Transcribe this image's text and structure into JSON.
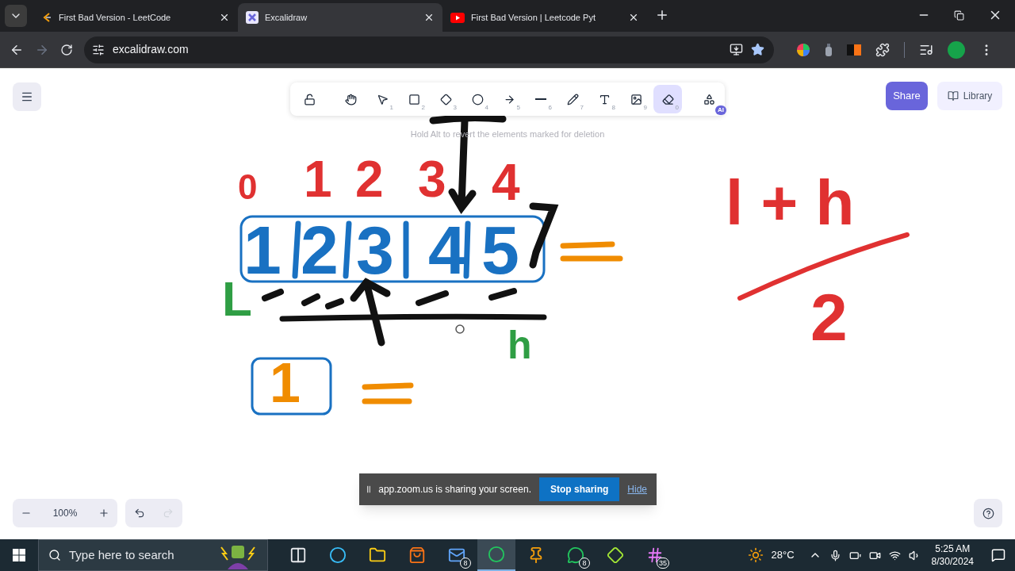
{
  "browser": {
    "tabs": [
      {
        "kind": "leetcode",
        "title": "First Bad Version - LeetCode",
        "selected": false
      },
      {
        "kind": "excalidraw",
        "title": "Excalidraw",
        "selected": true
      },
      {
        "kind": "youtube",
        "title": "First Bad Version | Leetcode Pyt",
        "selected": false
      }
    ],
    "url": "excalidraw.com"
  },
  "toolbar": {
    "tools": [
      {
        "kind": "lock",
        "selected": false
      },
      {
        "kind": "hand",
        "selected": false
      },
      {
        "kind": "select",
        "shortcut": "1",
        "selected": false
      },
      {
        "kind": "rectangle",
        "shortcut": "2",
        "selected": false
      },
      {
        "kind": "diamond",
        "shortcut": "3",
        "selected": false
      },
      {
        "kind": "ellipse",
        "shortcut": "4",
        "selected": false
      },
      {
        "kind": "arrow",
        "shortcut": "5",
        "selected": false
      },
      {
        "kind": "line",
        "shortcut": "6",
        "selected": false
      },
      {
        "kind": "draw",
        "shortcut": "7",
        "selected": false
      },
      {
        "kind": "text",
        "shortcut": "8",
        "selected": false
      },
      {
        "kind": "image",
        "shortcut": "9",
        "selected": false
      },
      {
        "kind": "eraser",
        "shortcut": "0",
        "selected": true
      },
      {
        "kind": "more",
        "badge": "AI",
        "selected": false
      }
    ]
  },
  "hint": "Hold Alt to revert the elements marked for deletion",
  "share": "Share",
  "library": "Library",
  "zoom": "100%",
  "canvas": {
    "labels": [
      {
        "text": "0",
        "color": "#e03131"
      },
      {
        "text": "1",
        "color": "#e03131"
      },
      {
        "text": "2",
        "color": "#e03131"
      },
      {
        "text": "3",
        "color": "#e03131"
      },
      {
        "text": "4",
        "color": "#e03131"
      },
      {
        "text": "1",
        "color": "#1971c2"
      },
      {
        "text": "2",
        "color": "#1971c2"
      },
      {
        "text": "3",
        "color": "#1971c2"
      },
      {
        "text": "4",
        "color": "#1971c2"
      },
      {
        "text": "5",
        "color": "#1971c2"
      },
      {
        "text": "L",
        "color": "#2f9e44"
      },
      {
        "text": "h",
        "color": "#2f9e44"
      },
      {
        "text": "1",
        "color": "#f08c00"
      },
      {
        "text": "l + h",
        "color": "#e03131"
      },
      {
        "text": "2",
        "color": "#e03131"
      }
    ]
  },
  "screen_share": {
    "message": "app.zoom.us is sharing your screen.",
    "stop": "Stop sharing",
    "hide": "Hide"
  },
  "taskbar": {
    "search_placeholder": "Type here to search",
    "apps": [
      {
        "kind": "task-view",
        "selected": false
      },
      {
        "kind": "edge",
        "selected": false
      },
      {
        "kind": "explorer",
        "selected": false
      },
      {
        "kind": "store",
        "selected": false
      },
      {
        "kind": "mail",
        "badge": "8",
        "selected": false
      },
      {
        "kind": "chrome",
        "selected": true
      },
      {
        "kind": "photos",
        "selected": false
      },
      {
        "kind": "whatsapp",
        "badge": "8",
        "selected": false
      },
      {
        "kind": "tool",
        "selected": false
      },
      {
        "kind": "slack",
        "badge": "35",
        "selected": false
      }
    ],
    "weather": "28°C",
    "time": "5:25 AM",
    "date": "8/30/2024"
  }
}
